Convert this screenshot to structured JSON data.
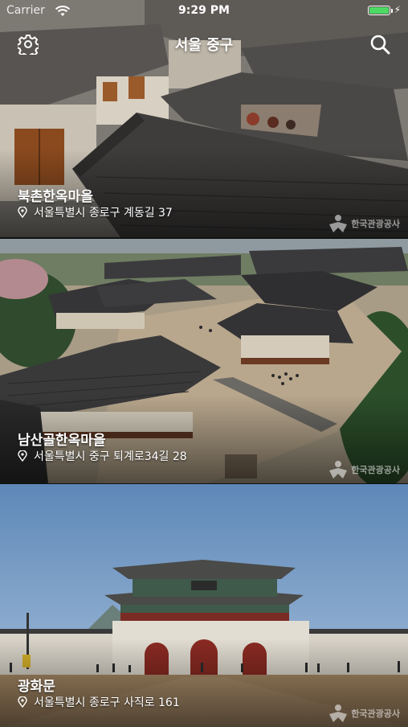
{
  "status_bar": {
    "carrier": "Carrier",
    "time": "9:29 PM",
    "battery_level": 1.0
  },
  "nav": {
    "title": "서울 중구",
    "settings_icon": "gear-icon",
    "search_icon": "search-icon"
  },
  "places": [
    {
      "title": "북촌한옥마을",
      "address": "서울특별시 종로구 계동길 37",
      "watermark": "한국관광공사"
    },
    {
      "title": "남산골한옥마을",
      "address": "서울특별시 중구 퇴계로34길 28",
      "watermark": "한국관광공사"
    },
    {
      "title": "광화문",
      "address": "서울특별시 종로구 사직로 161",
      "watermark": "한국관광공사"
    }
  ],
  "colors": {
    "battery": "#4cd964"
  }
}
